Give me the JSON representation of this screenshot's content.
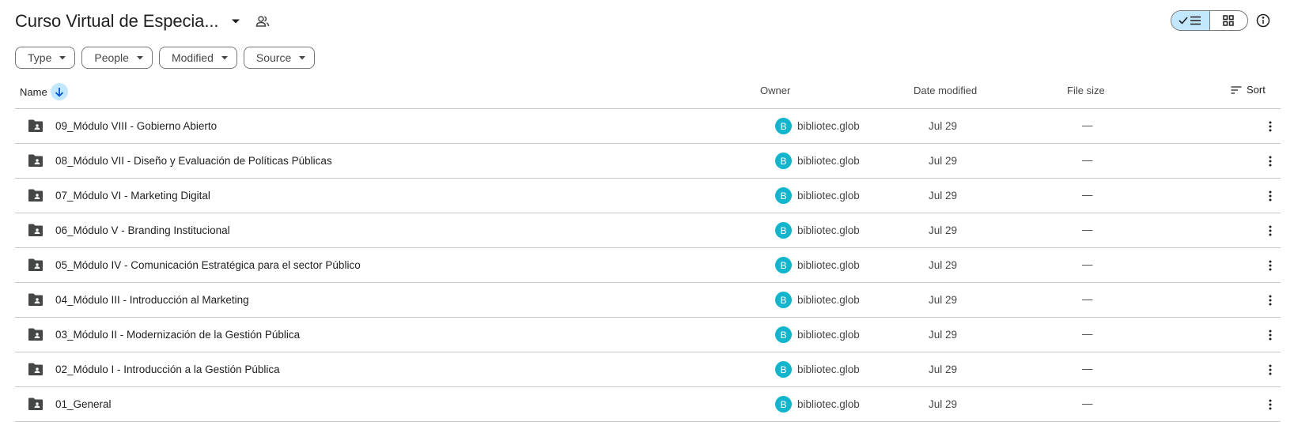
{
  "header": {
    "title": "Curso Virtual de Especia...",
    "title_dropdown_icon": "caret-down-icon",
    "shared_icon": "people-icon"
  },
  "view_toggle": {
    "list_icon": "check-list-icon",
    "grid_icon": "grid-icon",
    "active": "list"
  },
  "info_icon": "info-icon",
  "filters": [
    {
      "label": "Type"
    },
    {
      "label": "People"
    },
    {
      "label": "Modified"
    },
    {
      "label": "Source"
    }
  ],
  "columns": {
    "name": "Name",
    "owner": "Owner",
    "date": "Date modified",
    "size": "File size",
    "sort": "Sort"
  },
  "files": [
    {
      "name": "09_Módulo VIII - Gobierno Abierto",
      "owner_initial": "B",
      "owner": "bibliotec.glob",
      "date": "Jul 29",
      "size": "—"
    },
    {
      "name": "08_Módulo VII - Diseño y Evaluación de Políticas Públicas",
      "owner_initial": "B",
      "owner": "bibliotec.glob",
      "date": "Jul 29",
      "size": "—"
    },
    {
      "name": "07_Módulo VI - Marketing Digital",
      "owner_initial": "B",
      "owner": "bibliotec.glob",
      "date": "Jul 29",
      "size": "—"
    },
    {
      "name": "06_Módulo V - Branding Institucional",
      "owner_initial": "B",
      "owner": "bibliotec.glob",
      "date": "Jul 29",
      "size": "—"
    },
    {
      "name": "05_Módulo IV - Comunicación Estratégica para el sector Público",
      "owner_initial": "B",
      "owner": "bibliotec.glob",
      "date": "Jul 29",
      "size": "—"
    },
    {
      "name": "04_Módulo III - Introducción al Marketing",
      "owner_initial": "B",
      "owner": "bibliotec.glob",
      "date": "Jul 29",
      "size": "—"
    },
    {
      "name": "03_Módulo II - Modernización de la Gestión Pública",
      "owner_initial": "B",
      "owner": "bibliotec.glob",
      "date": "Jul 29",
      "size": "—"
    },
    {
      "name": "02_Módulo I - Introducción a la Gestión Pública",
      "owner_initial": "B",
      "owner": "bibliotec.glob",
      "date": "Jul 29",
      "size": "—"
    },
    {
      "name": "01_General",
      "owner_initial": "B",
      "owner": "bibliotec.glob",
      "date": "Jul 29",
      "size": "—"
    }
  ],
  "colors": {
    "accent_selected": "#c2e7ff",
    "avatar": "#12b5cb",
    "border": "#747775",
    "divider": "#c4c7c5"
  }
}
